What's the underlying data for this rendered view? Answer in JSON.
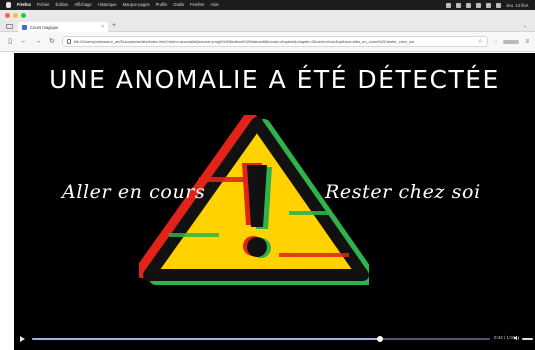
{
  "menubar": {
    "app": "Firefox",
    "items": [
      "Fichier",
      "Édition",
      "Affichage",
      "Historique",
      "Marque-pages",
      "Profils",
      "Outils",
      "Fenêtre",
      "Aide"
    ],
    "clock": "Jeu. 13 févr."
  },
  "browser": {
    "tab_title": "Cours magique",
    "url": "file:///Users/professeur_art/Documents/site/index.html?video=anomalie&source=projet%20bedford%20interactif&mode=chapitre&chapter=3&next=choix&options=aller_en_cours%2Crester_chez_soi",
    "new_tab": "+"
  },
  "video": {
    "headline": "UNE ANOMALIE A ÉTÉ DÉTECTÉE",
    "choice_left": "Aller en cours",
    "choice_right": "Rester chez soi",
    "progress": 0.76,
    "time": "0:42 / 1:02",
    "colors": {
      "triangle": "#ffd200",
      "outline": "#111111",
      "glitch_red": "#e2231a",
      "glitch_green": "#2fb34a",
      "accent": "#9fb4dc"
    }
  }
}
